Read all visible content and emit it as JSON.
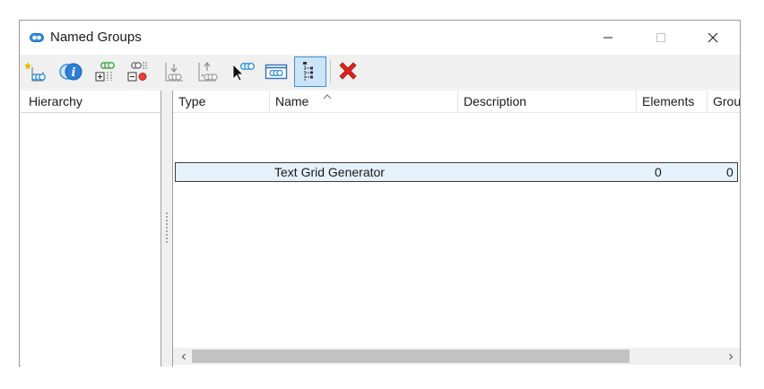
{
  "window": {
    "title": "Named Groups"
  },
  "toolbar": {
    "buttons": [
      {
        "name": "new-group-icon"
      },
      {
        "name": "group-info-icon"
      },
      {
        "name": "add-members-icon"
      },
      {
        "name": "remove-members-icon"
      },
      {
        "name": "add-to-group-icon"
      },
      {
        "name": "remove-from-group-icon"
      },
      {
        "name": "select-elements-icon"
      },
      {
        "name": "view-group-icon"
      },
      {
        "name": "hierarchy-view-icon",
        "active": true
      },
      {
        "name": "delete-icon"
      }
    ]
  },
  "left_pane": {
    "header": "Hierarchy"
  },
  "grid": {
    "columns": [
      "Type",
      "Name",
      "Description",
      "Elements",
      "Grou"
    ],
    "sort_column": "Name",
    "rows": [
      {
        "type": "",
        "name": "Text Grid Generator",
        "description": "",
        "elements": "0",
        "groups": "0"
      }
    ]
  },
  "colors": {
    "accent": "#3a8fd6",
    "selection": "#e5f1fb",
    "delete": "#d9251d"
  }
}
